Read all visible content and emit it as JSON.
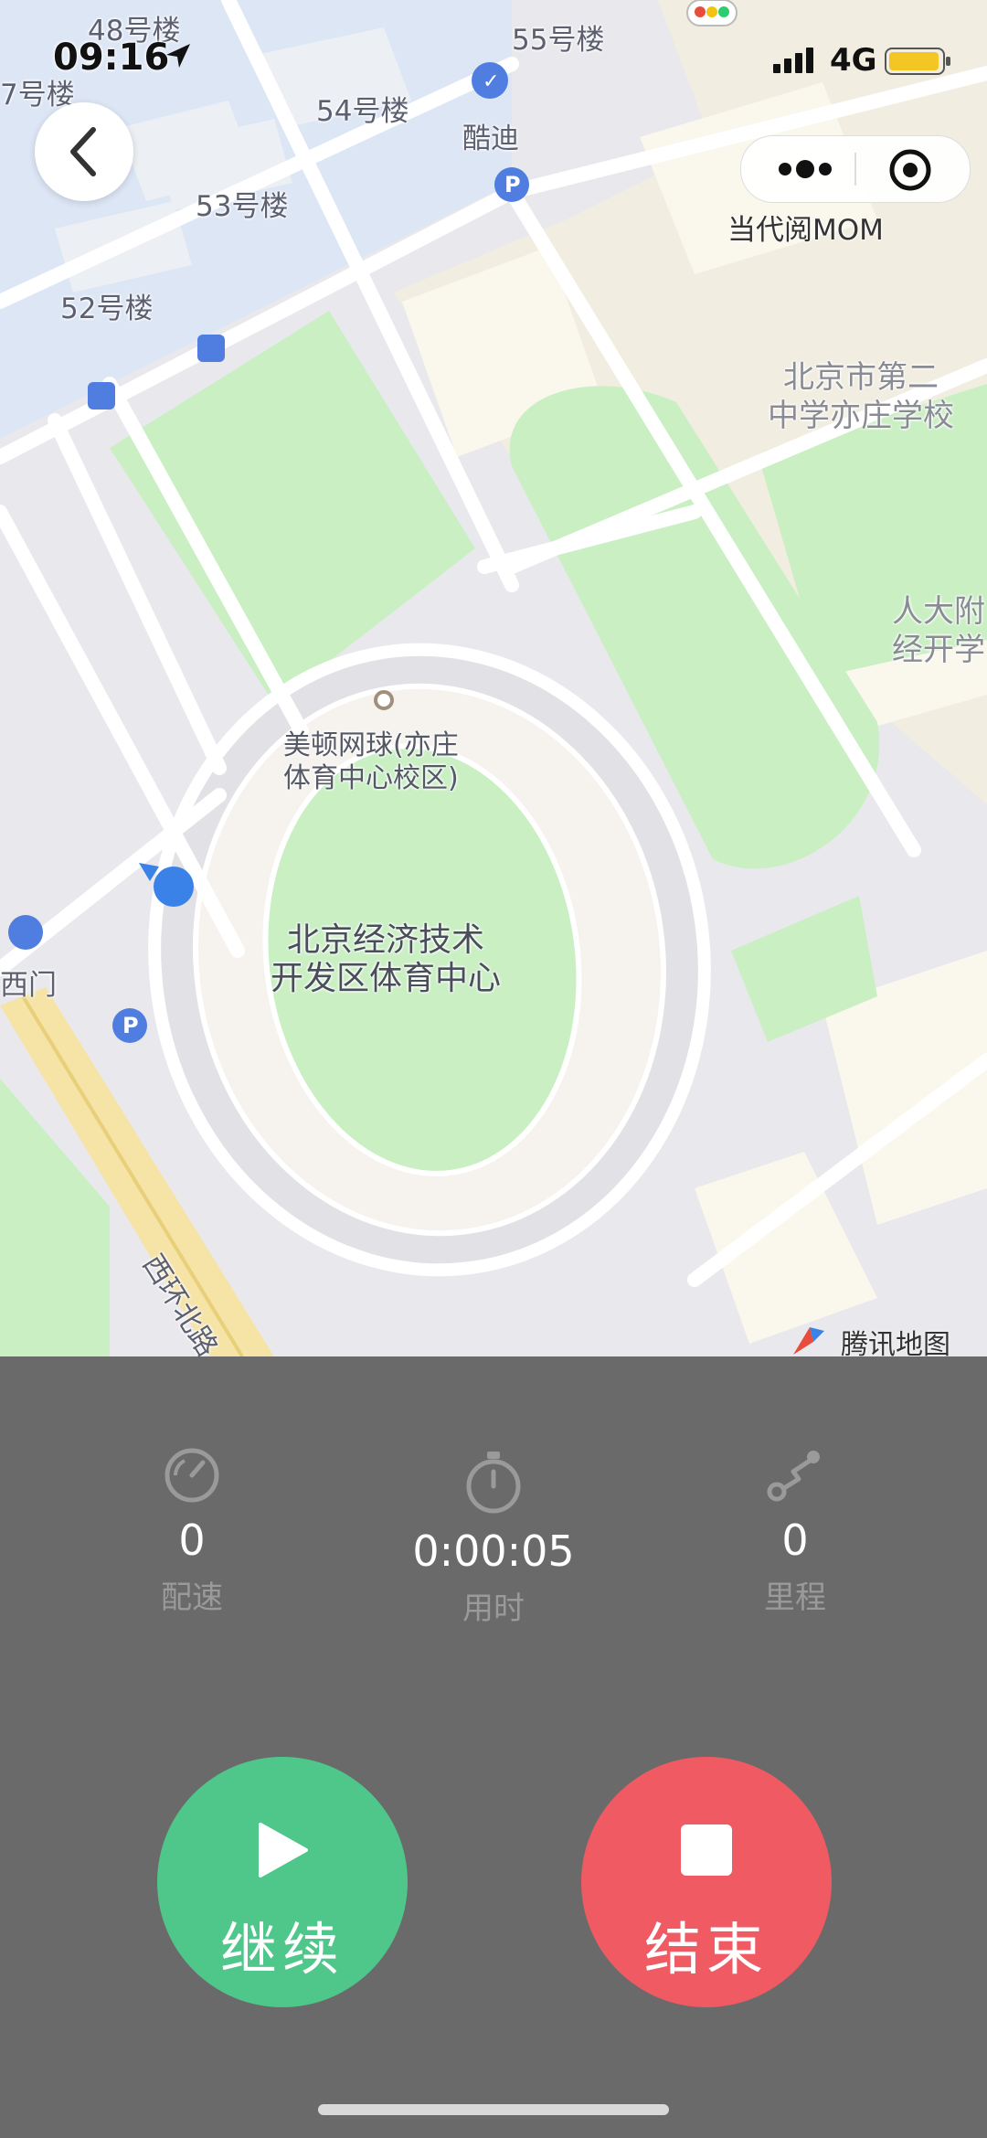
{
  "status_bar": {
    "time": "09:16",
    "network": "4G"
  },
  "header": {
    "app_title": "当代阅MOM"
  },
  "map": {
    "labels": {
      "b48": "48号楼",
      "b47": "7号楼",
      "b55": "55号楼",
      "b54": "54号楼",
      "b53": "53号楼",
      "b52": "52号楼",
      "kudi": "酷迪",
      "school_l1": "北京市第二",
      "school_l2": "中学亦庄学校",
      "renda_l1": "人大附",
      "renda_l2": "经开学",
      "tennis_l1": "美顿网球(亦庄",
      "tennis_l2": "体育中心校区)",
      "stadium_l1": "北京经济技术",
      "stadium_l2": "开发区体育中心",
      "ximen": "西门",
      "road": "西环北路"
    },
    "provider": "腾讯地图"
  },
  "stats": [
    {
      "value": "0",
      "label": "配速",
      "icon": "speedometer-icon"
    },
    {
      "value": "0:00:05",
      "label": "用时",
      "icon": "stopwatch-icon"
    },
    {
      "value": "0",
      "label": "里程",
      "icon": "route-icon"
    }
  ],
  "actions": {
    "continue_label": "继续",
    "end_label": "结束"
  },
  "colors": {
    "continue": "#4fc68a",
    "end": "#f05a63",
    "panel": "#6a6a6a",
    "location": "#3b82e8"
  }
}
